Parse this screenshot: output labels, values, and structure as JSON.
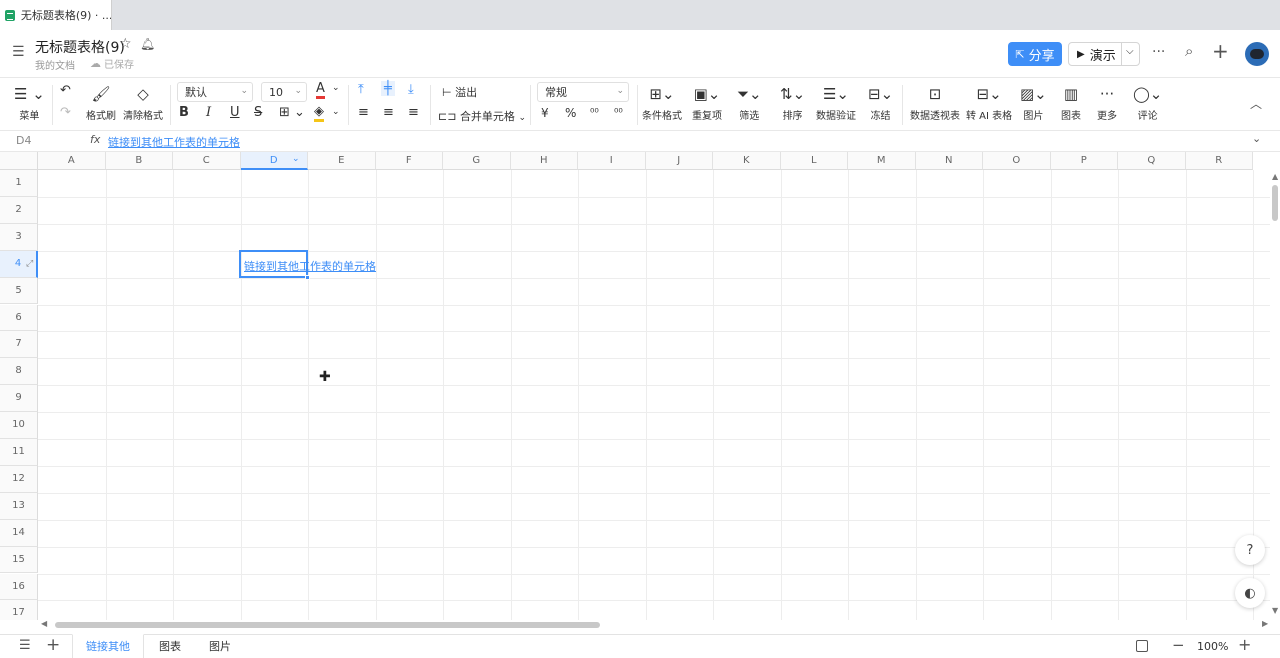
{
  "browser": {
    "tab_title": "无标题表格(9) · ..."
  },
  "doc": {
    "title": "无标题表格(9)",
    "breadcrumb": "我的文档",
    "save_status": "已保存",
    "share_label": "分享",
    "present_label": "演示"
  },
  "toolbar": {
    "menu_label": "菜单",
    "format_painter_label": "格式刷",
    "clear_format_label": "清除格式",
    "font_family": "默认",
    "font_size": "10",
    "overflow_label": "溢出",
    "merge_label": "合并单元格",
    "number_format": "常规",
    "currency_symbol": "¥",
    "percent_symbol": "%",
    "conditional_format_label": "条件格式",
    "duplicates_label": "重复项",
    "filter_label": "筛选",
    "sort_label": "排序",
    "data_validation_label": "数据验证",
    "freeze_label": "冻结",
    "pivot_label": "数据透视表",
    "ai_table_label": "转 AI 表格",
    "image_label": "图片",
    "chart_label": "图表",
    "more_label": "更多",
    "comment_label": "评论",
    "font_color": "#e53935",
    "fill_color": "#f5c518"
  },
  "formula_bar": {
    "cell_ref": "D4",
    "fx_label": "fx",
    "value": "链接到其他工作表的单元格"
  },
  "grid": {
    "columns": [
      "A",
      "B",
      "C",
      "D",
      "E",
      "F",
      "G",
      "H",
      "I",
      "J",
      "K",
      "L",
      "M",
      "N",
      "O",
      "P",
      "Q",
      "R"
    ],
    "rows": [
      "1",
      "2",
      "3",
      "4",
      "5",
      "6",
      "7",
      "8",
      "9",
      "10",
      "11",
      "12",
      "13",
      "14",
      "15",
      "16",
      "17"
    ],
    "active_column": "D",
    "active_row": "4",
    "cell_D4": "链接到其他工作表的单元格"
  },
  "sheets": {
    "tabs": [
      "链接其他",
      "图表",
      "图片"
    ],
    "active": "链接其他"
  },
  "zoom": {
    "value": "100%"
  },
  "colors": {
    "accent": "#3e8ef7"
  }
}
